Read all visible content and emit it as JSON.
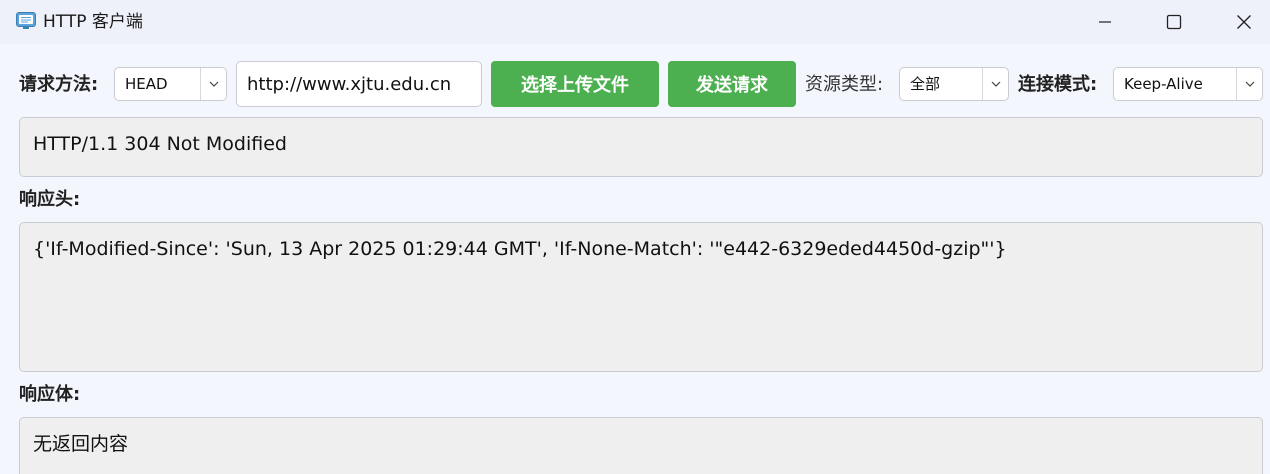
{
  "window": {
    "title": "HTTP 客户端",
    "icon": "monitor-app-icon",
    "controls": [
      "minimize-icon",
      "maximize-icon",
      "close-icon"
    ]
  },
  "toolbar": {
    "method_label": "请求方法:",
    "method_value": "HEAD",
    "url_value": "http://www.xjtu.edu.cn",
    "upload_button": "选择上传文件",
    "send_button": "发送请求",
    "resource_type_label": "资源类型:",
    "resource_type_value": "全部",
    "connection_mode_label": "连接模式:",
    "connection_mode_value": "Keep-Alive"
  },
  "status": {
    "text": "HTTP/1.1 304 Not Modified"
  },
  "headers": {
    "label": "响应头:",
    "text": "{'If-Modified-Since': 'Sun, 13 Apr 2025 01:29:44 GMT', 'If-None-Match': '\"e442-6329eded4450d-gzip\"'}"
  },
  "body": {
    "label": "响应体:",
    "text": "无返回内容"
  },
  "colors": {
    "accent_green": "#4cb050",
    "background": "#f3f6fc",
    "panel": "#efefef"
  }
}
